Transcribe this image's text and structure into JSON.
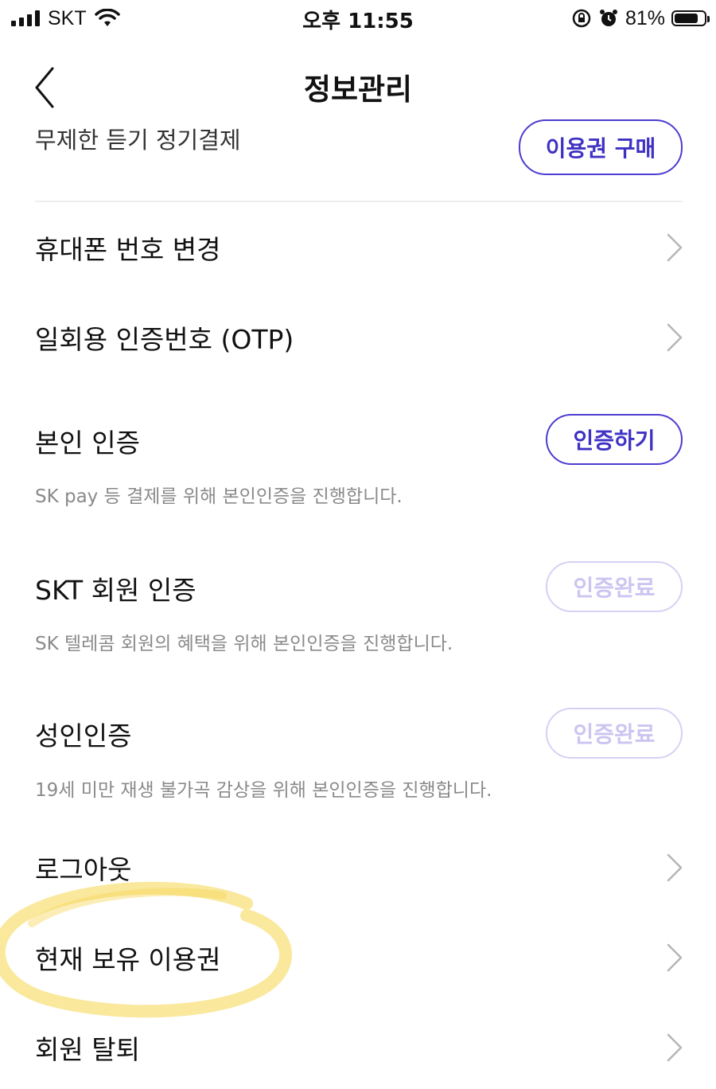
{
  "status_bar": {
    "carrier": "SKT",
    "time": "오후 11:55",
    "battery_percent": "81%",
    "battery_level": 0.81,
    "icons": [
      "signal-icon",
      "wifi-icon",
      "orientation-lock-icon",
      "alarm-icon",
      "battery-icon"
    ]
  },
  "navbar": {
    "title": "정보관리",
    "back_icon": "chevron-left-icon"
  },
  "cut_row": {
    "text": "무제한 듣기 정기결제",
    "button_label": "이용권 구매"
  },
  "rows": {
    "phone_change": {
      "title": "휴대폰 번호 변경"
    },
    "otp": {
      "title": "일회용 인증번호 (OTP)"
    },
    "self_verify": {
      "title": "본인 인증",
      "button_label": "인증하기",
      "description": "SK pay 등 결제를 위해 본인인증을 진행합니다."
    },
    "skt_member": {
      "title": "SKT 회원 인증",
      "button_label": "인증완료",
      "description": "SK 텔레콤 회원의 혜택을 위해 본인인증을 진행합니다."
    },
    "adult": {
      "title": "성인인증",
      "button_label": "인증완료",
      "description": "19세 미만 재생 불가곡 감상을 위해 본인인증을 진행합니다."
    },
    "logout": {
      "title": "로그아웃"
    },
    "current_pass": {
      "title": "현재 보유 이용권"
    },
    "withdraw": {
      "title": "회원 탈퇴"
    }
  },
  "colors": {
    "accent": "#3f31c4",
    "accent_disabled": "#cbc5f1",
    "description_text": "#8a8a8a",
    "chevron": "#b5b5b5",
    "highlight": "#f7d85a"
  }
}
